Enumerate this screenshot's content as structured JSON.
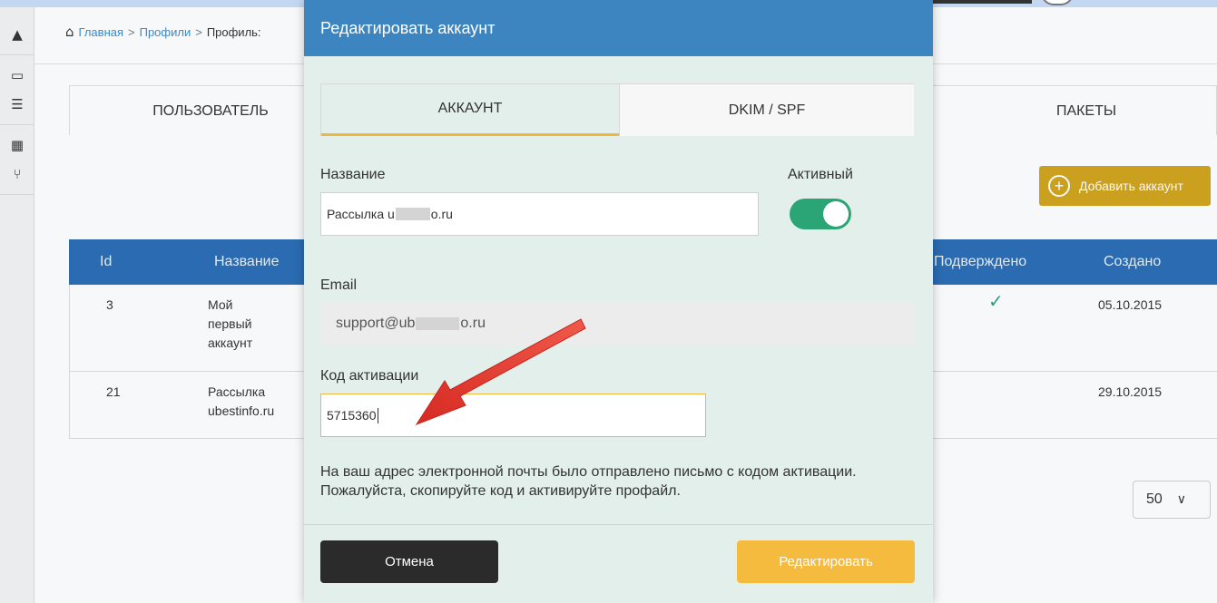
{
  "breadcrumb": {
    "home": "Главная",
    "profiles": "Профили",
    "current": "Профиль:"
  },
  "page_tabs": {
    "user": "ПОЛЬЗОВАТЕЛЬ",
    "packages": "ПАКЕТЫ"
  },
  "add_account_label": "Добавить аккаунт",
  "table": {
    "columns": {
      "id": "Id",
      "name": "Название",
      "confirmed": "Подверждено",
      "created": "Создано"
    },
    "rows": [
      {
        "id": "3",
        "name_lines": [
          "Мой",
          "первый",
          "аккаунт"
        ],
        "confirmed": true,
        "created": "05.10.2015"
      },
      {
        "id": "21",
        "name_lines": [
          "Рассылка",
          "ubestinfo.ru"
        ],
        "confirmed": false,
        "created": "29.10.2015"
      }
    ]
  },
  "pagination": {
    "per_page": "50"
  },
  "modal": {
    "title": "Редактировать аккаунт",
    "tabs": {
      "account": "АККАУНТ",
      "dkim": "DKIM / SPF"
    },
    "name_label": "Название",
    "name_value_prefix": "Рассылка u",
    "name_value_suffix": "o.ru",
    "active_label": "Активный",
    "active": true,
    "email_label": "Email",
    "email_value_prefix": "support@ub",
    "email_value_suffix": "o.ru",
    "code_label": "Код активации",
    "code_value": "5715360",
    "note": "На ваш адрес электронной почты было отправлено письмо с кодом активации. Пожалуйста, скопируйте код и активируйте профайл.",
    "cancel_label": "Отмена",
    "submit_label": "Редактировать"
  },
  "colors": {
    "header_blue": "#3d85c0",
    "table_header": "#2a6db5",
    "accent_yellow": "#f4bb3f",
    "toggle_green": "#2ba576",
    "arrow_red": "#e8372f"
  }
}
